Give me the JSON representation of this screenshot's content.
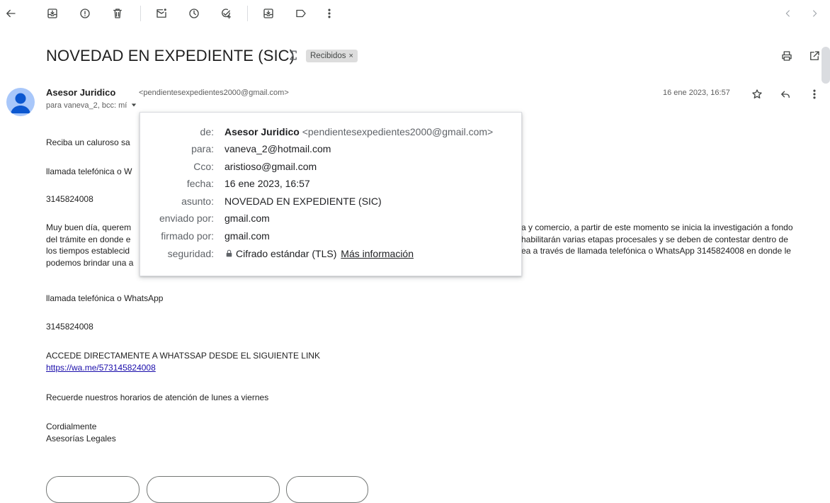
{
  "toolbar": {
    "icons": [
      "back-arrow-icon",
      "archive-icon",
      "report-spam-icon",
      "delete-icon",
      "mark-unread-icon",
      "snooze-icon",
      "add-task-icon",
      "move-to-icon",
      "label-icon",
      "more-vert-icon"
    ],
    "pager_icons": [
      "chevron-left-icon",
      "chevron-right-icon"
    ]
  },
  "email": {
    "subject": "NOVEDAD EN EXPEDIENTE (SIC)",
    "label": "Recibidos",
    "label_remove": "×",
    "sender_name": "Asesor Juridico",
    "sender_email": "<pendientesexpedientes2000@gmail.com>",
    "to_line": "para vaneva_2, bcc: mí",
    "date": "16 ene 2023, 16:57"
  },
  "body": {
    "p1": "Reciba un caluroso sa",
    "p2": "llamada telefónica o W",
    "p3": "3145824008",
    "p4_line1_left": "Muy buen día, querem",
    "p4_line1_right": "a y comercio, a partir de este momento se inicia la investigación a fondo",
    "p4_line2_left": "del trámite en donde e",
    "p4_line2_right": "habilitarán varias etapas procesales y se deben de contestar dentro de",
    "p4_line3_left": "los tiempos establecid",
    "p4_line3_right": "ea a través de llamada telefónica o WhatsApp 3145824008 en donde le",
    "p4_line4_left": "podemos brindar una a",
    "p5": "llamada telefónica o WhatsApp",
    "p6": "3145824008",
    "p7": "ACCEDE DIRECTAMENTE  A WHATSSAP DESDE EL SIGUIENTE LINK",
    "link": "https://wa.me/573145824008",
    "p8": "Recuerde nuestros horarios de atención de lunes a viernes",
    "p9a": "Cordialmente",
    "p9b": "Asesorías Legales"
  },
  "details": {
    "de_label": "de:",
    "de_name": "Asesor Juridico",
    "de_email": "<pendientesexpedientes2000@gmail.com>",
    "para_label": "para:",
    "para_value": "vaneva_2@hotmail.com",
    "cco_label": "Cco:",
    "cco_value": "aristioso@gmail.com",
    "fecha_label": "fecha:",
    "fecha_value": "16 ene 2023, 16:57",
    "asunto_label": "asunto:",
    "asunto_value": "NOVEDAD EN EXPEDIENTE (SIC)",
    "enviado_label": "enviado por:",
    "enviado_value": "gmail.com",
    "firmado_label": "firmado por:",
    "firmado_value": "gmail.com",
    "seguridad_label": "seguridad:",
    "seguridad_value": "Cifrado estándar (TLS)",
    "seguridad_link": "Más información"
  },
  "colors": {
    "avatar_bg": "#a8c7fa",
    "avatar_fg": "#0b57d0",
    "link": "#1a0dab"
  }
}
